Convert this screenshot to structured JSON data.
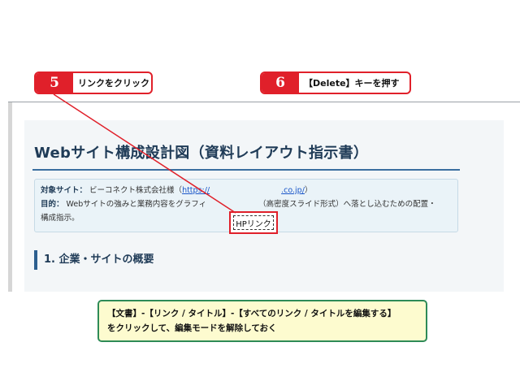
{
  "steps": [
    {
      "number": "5",
      "text": "リンクをクリック"
    },
    {
      "number": "6",
      "text": "【Delete】キーを押す"
    }
  ],
  "document": {
    "title": "Webサイト構成設計図（資料レイアウト指示書）",
    "target_label": "対象サイト：",
    "target_value": "ビーコネクト株式会社様（",
    "target_url": "https://",
    "target_url_tail": ".co.jp/",
    "target_close": "）",
    "purpose_label": "目的：",
    "purpose_value": "Webサイトの強みと業務内容をグラフィ",
    "purpose_value_2": "（高密度スライド形式）へ落とし込むための配置・",
    "purpose_value_3": "構成指示。",
    "section_1": "1. 企業・サイトの概要",
    "hp_link": "HPリンク"
  },
  "instruction": {
    "line1": "【文書】-【リンク / タイトル】-【すべてのリンク / タイトルを編集する】",
    "line2": "をクリックして、編集モードを解除しておく"
  },
  "colors": {
    "callout_red": "#e0202a",
    "instruction_border": "#2e8b57",
    "instruction_bg": "#fdfbcf",
    "title_navy": "#1f3b57"
  }
}
